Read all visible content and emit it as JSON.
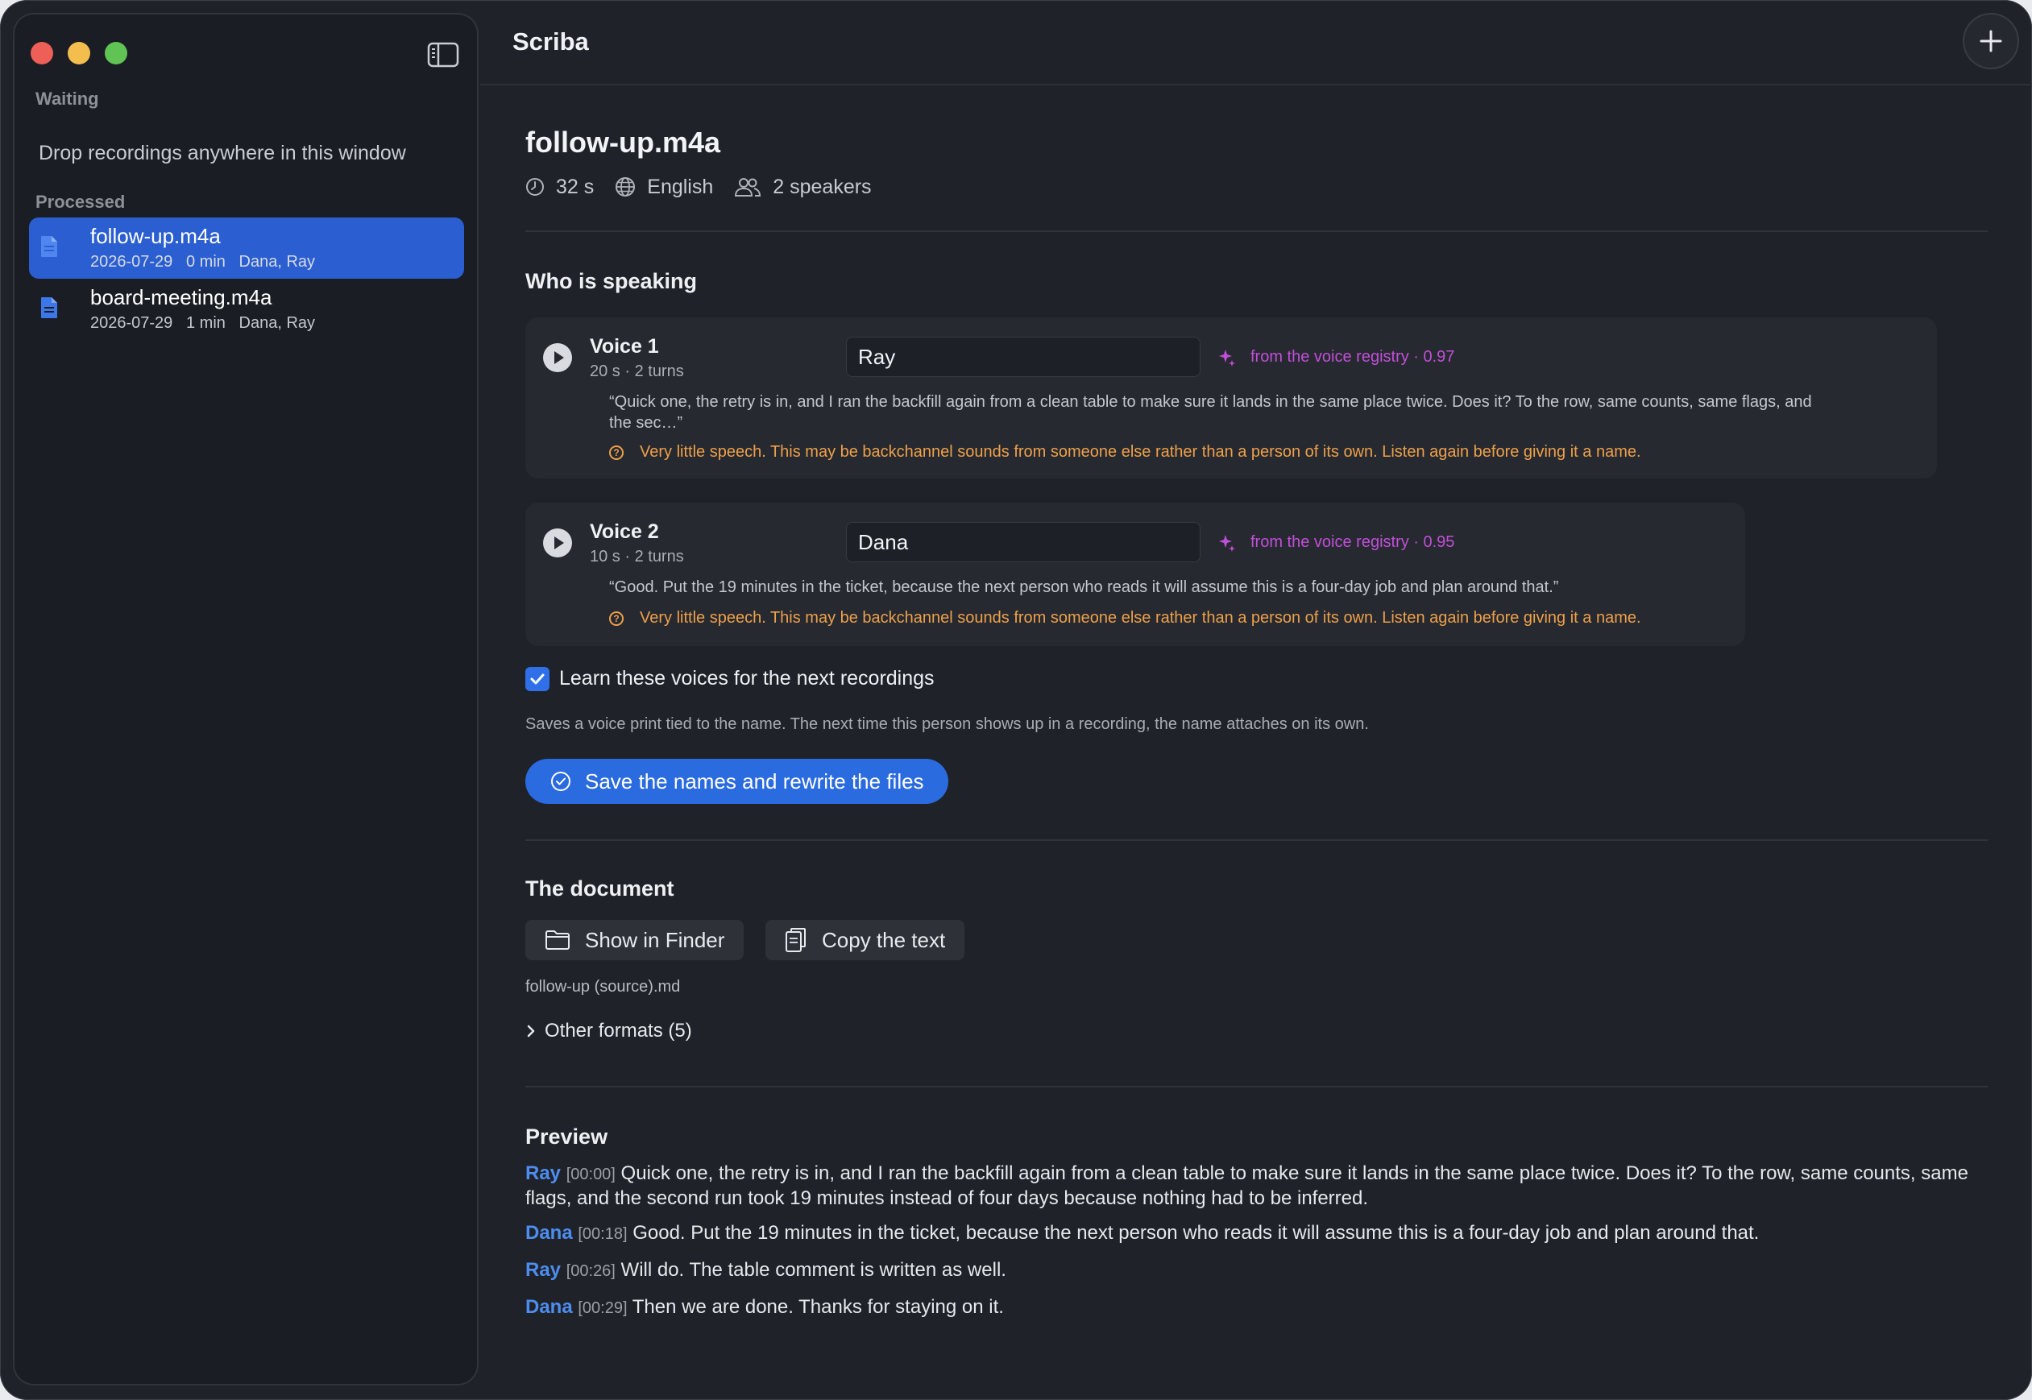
{
  "app": {
    "title": "Scriba"
  },
  "sidebar": {
    "waiting_label": "Waiting",
    "drop_hint": "Drop recordings anywhere in this window",
    "processed_label": "Processed",
    "items": [
      {
        "name": "follow-up.m4a",
        "meta": "2026-07-29   0 min   Dana, Ray",
        "selected": true
      },
      {
        "name": "board-meeting.m4a",
        "meta": "2026-07-29   1 min   Dana, Ray",
        "selected": false
      }
    ]
  },
  "file": {
    "title": "follow-up.m4a",
    "duration": "32 s",
    "language": "English",
    "speakers": "2 speakers"
  },
  "speaking": {
    "heading": "Who is speaking",
    "voices": [
      {
        "label": "Voice 1",
        "sub": "20 s · 2 turns",
        "name_value": "Ray",
        "registry": "from the voice registry · 0.97",
        "quote_line1": "“Quick one, the retry is in, and I ran the backfill again from a clean table to make sure it lands in the same place twice. Does it? To the row, same counts, same flags, and",
        "quote_line2": "the sec…”",
        "warning": "Very little speech. This may be backchannel sounds from someone else rather than a person of its own. Listen again before giving it a name."
      },
      {
        "label": "Voice 2",
        "sub": "10 s · 2 turns",
        "name_value": "Dana",
        "registry": "from the voice registry · 0.95",
        "quote_line1": "“Good. Put the 19 minutes in the ticket, because the next person who reads it will assume this is a four-day job and plan around that.”",
        "warning": "Very little speech. This may be backchannel sounds from someone else rather than a person of its own. Listen again before giving it a name."
      }
    ],
    "learn_label": "Learn these voices for the next recordings",
    "learn_checked": true,
    "learn_help": "Saves a voice print tied to the name. The next time this person shows up in a recording, the name attaches on its own.",
    "save_button": "Save the names and rewrite the files"
  },
  "document": {
    "heading": "The document",
    "show_in_finder": "Show in Finder",
    "copy_text": "Copy the text",
    "filename": "follow-up (source).md",
    "other_formats": "Other formats (5)"
  },
  "preview": {
    "heading": "Preview",
    "lines": [
      {
        "speaker": "Ray",
        "time": "[00:00]",
        "text": "Quick one, the retry is in, and I ran the backfill again from a clean table to make sure it lands in the same place twice. Does it? To the row, same counts, same flags, and the second run took 19 minutes instead of four days because nothing had to be inferred."
      },
      {
        "speaker": "Dana",
        "time": "[00:18]",
        "text": "Good. Put the 19 minutes in the ticket, because the next person who reads it will assume this is a four-day job and plan around that."
      },
      {
        "speaker": "Ray",
        "time": "[00:26]",
        "text": "Will do. The table comment is written as well."
      },
      {
        "speaker": "Dana",
        "time": "[00:29]",
        "text": "Then we are done. Thanks for staying on it."
      }
    ]
  },
  "colors": {
    "accent": "#2b6be0",
    "speaker": "#4d8df0",
    "registry": "#c14fd8",
    "warning": "#eea04a"
  }
}
